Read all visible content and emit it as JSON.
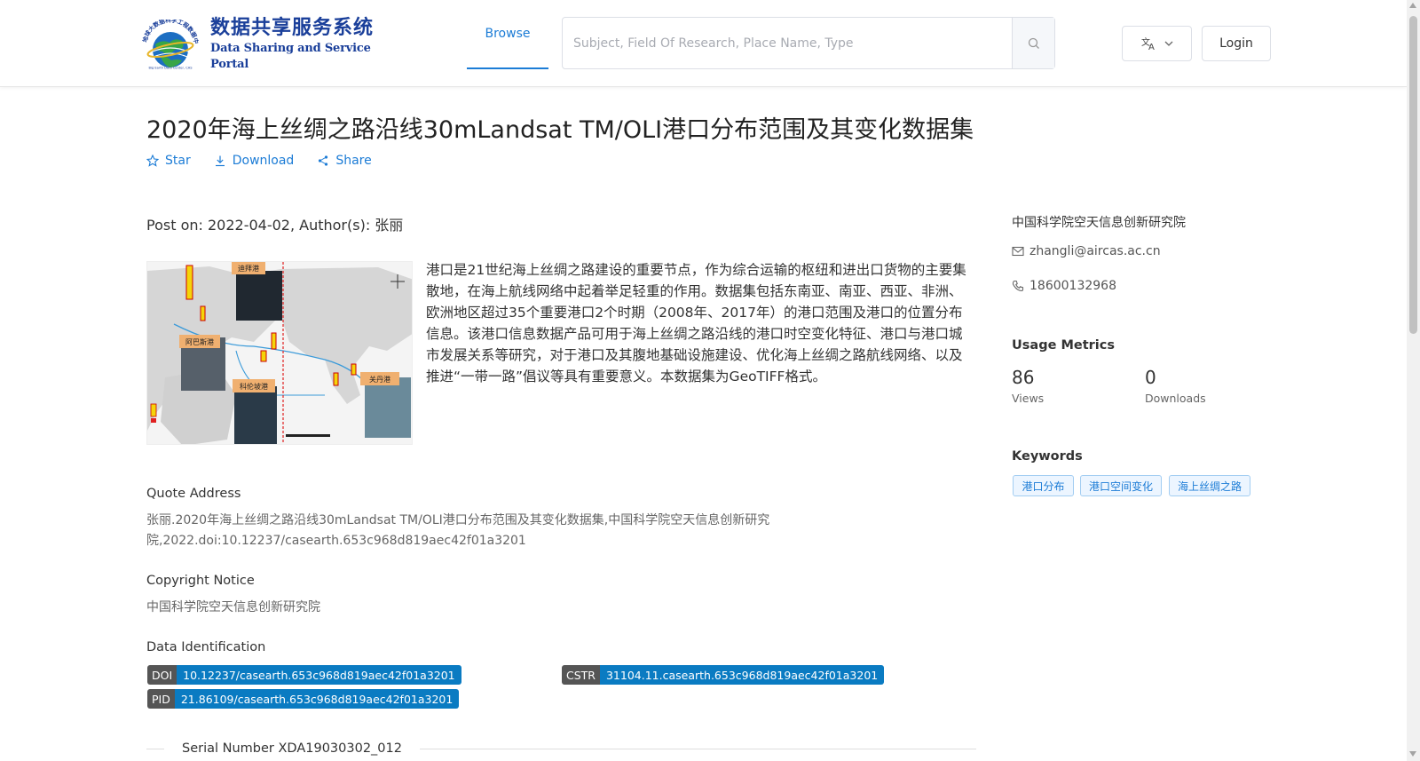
{
  "header": {
    "logo": {
      "cn": "数据共享服务系统",
      "en": "Data Sharing and Service Portal",
      "ring_text": "地球大数据科学工程数据中心"
    },
    "nav": {
      "browse_label": "Browse"
    },
    "search": {
      "placeholder": "Subject, Field Of Research, Place Name, Type",
      "value": ""
    },
    "language_icon": "translate-icon",
    "login_label": "Login"
  },
  "dataset": {
    "title": "2020年海上丝绸之路沿线30mLandsat TM/OLI港口分布范围及其变化数据集",
    "actions": {
      "star": "Star",
      "download": "Download",
      "share": "Share"
    },
    "post_info": "Post on: 2022-04-02, Author(s): 张丽",
    "thumbnail_labels": {
      "a": "迪拜港",
      "b": "阿巴斯港",
      "c": "科伦坡港",
      "d": "关丹港"
    },
    "description": "港口是21世纪海上丝绸之路建设的重要节点，作为综合运输的枢纽和进出口货物的主要集散地，在海上航线网络中起着举足轻重的作用。数据集包括东南亚、南亚、西亚、非洲、欧洲地区超过35个重要港口2个时期（2008年、2017年）的港口范围及港口的位置分布信息。该港口信息数据产品可用于海上丝绸之路沿线的港口时空变化特征、港口与港口城市发展关系等研究，对于港口及其腹地基础设施建设、优化海上丝绸之路航线网络、以及推进“一带一路”倡议等具有重要意义。本数据集为GeoTIFF格式。",
    "quote_address": {
      "title": "Quote Address",
      "text_line1": "张丽.2020年海上丝绸之路沿线30mLandsat TM/OLI港口分布范围及其变化数据集,中国科学院空天信息创新研究",
      "text_line2": "院,2022.doi:10.12237/casearth.653c968d819aec42f01a3201"
    },
    "copyright": {
      "title": "Copyright Notice",
      "text": "中国科学院空天信息创新研究院"
    },
    "identification": {
      "title": "Data Identification",
      "doi": {
        "key": "DOI",
        "value": "10.12237/casearth.653c968d819aec42f01a3201"
      },
      "cstr": {
        "key": "CSTR",
        "value": "31104.11.casearth.653c968d819aec42f01a3201"
      },
      "pid": {
        "key": "PID",
        "value": "21.86109/casearth.653c968d819aec42f01a3201"
      }
    },
    "serial_number": "Serial Number XDA19030302_012"
  },
  "sidebar": {
    "organization": "中国科学院空天信息创新研究院",
    "email": "zhangli@aircas.ac.cn",
    "phone": "18600132968",
    "usage_metrics": {
      "title": "Usage Metrics",
      "views": {
        "value": "86",
        "label": "Views"
      },
      "downloads": {
        "value": "0",
        "label": "Downloads"
      }
    },
    "keywords": {
      "title": "Keywords",
      "items": [
        "港口分布",
        "港口空间变化",
        "海上丝绸之路"
      ]
    }
  },
  "colors": {
    "accent": "#1c7cd6",
    "badge_value": "#0a7bc2",
    "badge_key": "#555555",
    "logo_blue": "#1a3f9a"
  }
}
